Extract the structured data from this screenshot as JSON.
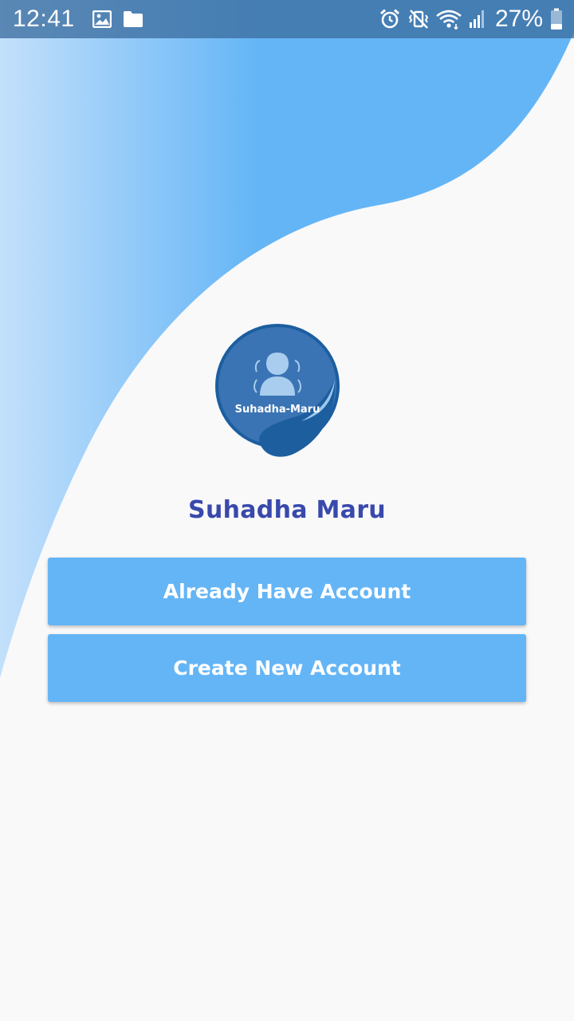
{
  "status_bar": {
    "time": "12:41",
    "battery": "27%",
    "icons_left": [
      "image-icon",
      "folder-icon"
    ],
    "icons_right": [
      "alarm-icon",
      "vibrate-icon",
      "wifi-icon",
      "signal-icon",
      "battery-icon"
    ]
  },
  "logo": {
    "caption": "Suhadha-Maru"
  },
  "app": {
    "title": "Suhadha Maru"
  },
  "buttons": {
    "login_label": "Already Have Account",
    "signup_label": "Create New Account"
  },
  "colors": {
    "accent": "#64b5f6",
    "title": "#3949ab",
    "logo": "#3a74b4"
  }
}
